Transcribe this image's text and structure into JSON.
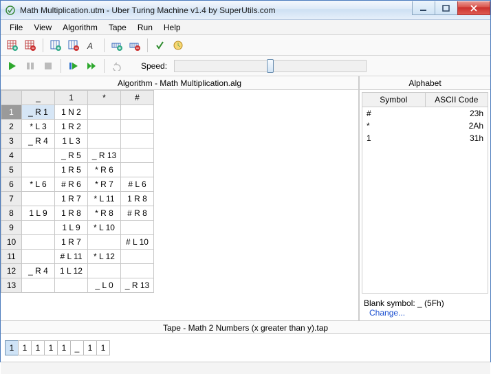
{
  "window": {
    "title": "Math Multiplication.utm - Uber Turing Machine v1.4 by SuperUtils.com"
  },
  "menu": {
    "items": [
      "File",
      "View",
      "Algorithm",
      "Tape",
      "Run",
      "Help"
    ]
  },
  "runbar": {
    "speed_label": "Speed:"
  },
  "algorithm": {
    "header": "Algorithm - Math Multiplication.alg",
    "columns": [
      "_",
      "1",
      "*",
      "#"
    ],
    "rows": [
      {
        "n": "1",
        "cells": [
          "_ R 1",
          "1 N 2",
          "",
          ""
        ]
      },
      {
        "n": "2",
        "cells": [
          "* L 3",
          "1 R 2",
          "",
          ""
        ]
      },
      {
        "n": "3",
        "cells": [
          "_ R 4",
          "1 L 3",
          "",
          ""
        ]
      },
      {
        "n": "4",
        "cells": [
          "",
          "_ R 5",
          "_ R 13",
          ""
        ]
      },
      {
        "n": "5",
        "cells": [
          "",
          "1 R 5",
          "* R 6",
          ""
        ]
      },
      {
        "n": "6",
        "cells": [
          "* L 6",
          "# R 6",
          "* R 7",
          "# L 6"
        ]
      },
      {
        "n": "7",
        "cells": [
          "",
          "1 R 7",
          "* L 11",
          "1 R 8"
        ]
      },
      {
        "n": "8",
        "cells": [
          "1 L 9",
          "1 R 8",
          "* R 8",
          "# R 8"
        ]
      },
      {
        "n": "9",
        "cells": [
          "",
          "1 L 9",
          "* L 10",
          ""
        ]
      },
      {
        "n": "10",
        "cells": [
          "",
          "1 R 7",
          "",
          "# L 10"
        ]
      },
      {
        "n": "11",
        "cells": [
          "",
          "# L 11",
          "* L 12",
          ""
        ]
      },
      {
        "n": "12",
        "cells": [
          "_ R 4",
          "1 L 12",
          "",
          ""
        ]
      },
      {
        "n": "13",
        "cells": [
          "",
          "",
          "_ L 0",
          "_ R 13"
        ]
      }
    ]
  },
  "alphabet": {
    "header": "Alphabet",
    "cols": [
      "Symbol",
      "ASCII Code"
    ],
    "rows": [
      {
        "sym": "#",
        "code": "23h"
      },
      {
        "sym": "*",
        "code": "2Ah"
      },
      {
        "sym": "1",
        "code": "31h"
      }
    ],
    "blank_label": "Blank symbol: _ (5Fh)",
    "change": "Change..."
  },
  "tape": {
    "header": "Tape - Math 2 Numbers (x greater than y).tap",
    "cells": [
      "1",
      "1",
      "1",
      "1",
      "1",
      "_",
      "1",
      "1"
    ],
    "head": 0
  }
}
